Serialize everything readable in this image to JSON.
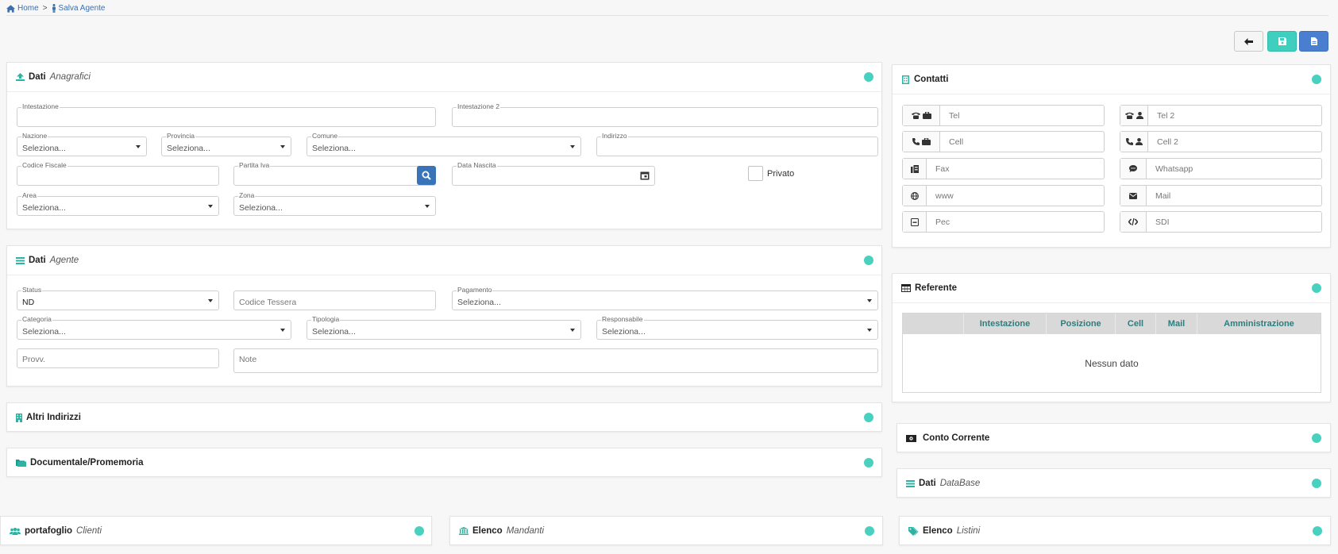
{
  "breadcrumb": {
    "home": "Home",
    "separator": ">",
    "current": "Salva Agente"
  },
  "colors": {
    "accent": "#49d1c0",
    "link": "#3a6fb0",
    "save": "#3fcfbf",
    "doc": "#4a7fd0",
    "table_header_text": "#2e7d7d"
  },
  "toolbar": {
    "back_icon": "arrow-left-icon",
    "save_icon": "floppy-icon",
    "doc_icon": "file-icon"
  },
  "anagrafici": {
    "title": "Dati",
    "subtitle": "Anagrafici",
    "intestazione": "Intestazione",
    "intestazione2": "Intestazione 2",
    "nazione": "Nazione",
    "nazione_value": "Seleziona...",
    "provincia": "Provincia",
    "provincia_value": "Seleziona...",
    "comune": "Comune",
    "comune_value": "Seleziona...",
    "indirizzo": "Indirizzo",
    "codice_fiscale": "Codice Fiscale",
    "partita_iva": "Partita Iva",
    "data_nascita": "Data Nascita",
    "privato": "Privato",
    "area": "Area",
    "area_value": "Seleziona...",
    "zona": "Zona",
    "zona_value": "Seleziona..."
  },
  "agente": {
    "title": "Dati",
    "subtitle": "Agente",
    "status": "Status",
    "status_value": "ND",
    "codice_tessera": "Codice Tessera",
    "pagamento": "Pagamento",
    "pagamento_value": "Seleziona...",
    "categoria": "Categoria",
    "categoria_value": "Seleziona...",
    "tipologia": "Tipologia",
    "tipologia_value": "Seleziona...",
    "responsabile": "Responsabile",
    "responsabile_value": "Seleziona...",
    "provv": "Provv.",
    "note": "Note"
  },
  "altri_indirizzi": {
    "title": "Altri Indirizzi"
  },
  "documentale": {
    "title": "Documentale/Promemoria"
  },
  "contatti": {
    "title": "Contatti",
    "tel": "Tel",
    "tel2": "Tel 2",
    "cell": "Cell",
    "cell2": "Cell 2",
    "fax": "Fax",
    "whatsapp": "Whatsapp",
    "www": "www",
    "mail": "Mail",
    "pec": "Pec",
    "sdi": "SDI"
  },
  "referente": {
    "title": "Referente",
    "columns": [
      "",
      "Intestazione",
      "Posizione",
      "Cell",
      "Mail",
      "Amministrazione"
    ],
    "empty": "Nessun dato"
  },
  "conto_corrente": {
    "title": "Conto Corrente"
  },
  "database": {
    "title": "Dati",
    "subtitle": "DataBase"
  },
  "portafoglio": {
    "title": "portafoglio",
    "subtitle": "Clienti"
  },
  "mandanti": {
    "title": "Elenco",
    "subtitle": "Mandanti"
  },
  "listini": {
    "title": "Elenco",
    "subtitle": "Listini"
  }
}
